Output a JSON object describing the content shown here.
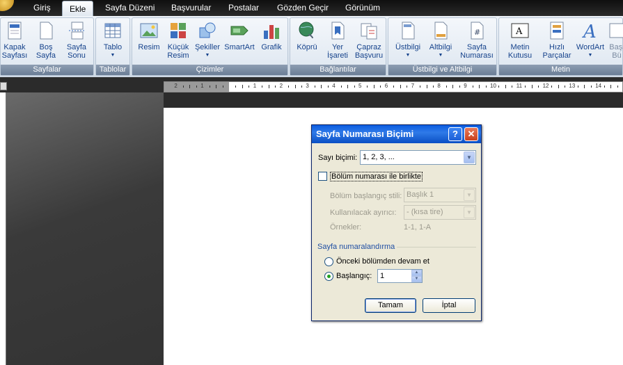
{
  "tabs": [
    "Giriş",
    "Ekle",
    "Sayfa Düzeni",
    "Başvurular",
    "Postalar",
    "Gözden Geçir",
    "Görünüm"
  ],
  "active_tab": "Ekle",
  "groups": {
    "sayfalar": {
      "label": "Sayfalar",
      "buttons": [
        {
          "l1": "Kapak",
          "l2": "Sayfası"
        },
        {
          "l1": "Boş",
          "l2": "Sayfa"
        },
        {
          "l1": "Sayfa",
          "l2": "Sonu"
        }
      ]
    },
    "tablolar": {
      "label": "Tablolar",
      "buttons": [
        {
          "l1": "Tablo",
          "l2": ""
        }
      ]
    },
    "cizimler": {
      "label": "Çizimler",
      "buttons": [
        {
          "l1": "Resim",
          "l2": ""
        },
        {
          "l1": "Küçük",
          "l2": "Resim"
        },
        {
          "l1": "Şekiller",
          "l2": ""
        },
        {
          "l1": "SmartArt",
          "l2": ""
        },
        {
          "l1": "Grafik",
          "l2": ""
        }
      ]
    },
    "baglantilar": {
      "label": "Bağlantılar",
      "buttons": [
        {
          "l1": "Köprü",
          "l2": ""
        },
        {
          "l1": "Yer",
          "l2": "İşareti"
        },
        {
          "l1": "Çapraz",
          "l2": "Başvuru"
        }
      ]
    },
    "ustbilgi": {
      "label": "Üstbilgi ve Altbilgi",
      "buttons": [
        {
          "l1": "Üstbilgi",
          "l2": ""
        },
        {
          "l1": "Altbilgi",
          "l2": ""
        },
        {
          "l1": "Sayfa",
          "l2": "Numarası"
        }
      ]
    },
    "metin": {
      "label": "Metin",
      "buttons": [
        {
          "l1": "Metin",
          "l2": "Kutusu"
        },
        {
          "l1": "Hızlı",
          "l2": "Parçalar"
        },
        {
          "l1": "WordArt",
          "l2": ""
        },
        {
          "l1": "Başl",
          "l2": "Bü"
        }
      ]
    }
  },
  "ruler_numbers": [
    "2",
    "1",
    "1",
    "2",
    "3",
    "4",
    "5",
    "6",
    "7",
    "8",
    "9",
    "10",
    "11",
    "12",
    "13",
    "14"
  ],
  "dialog": {
    "title": "Sayfa Numarası Biçimi",
    "help": "?",
    "close": "✕",
    "sayi_bicimi_label": "Sayı biçimi:",
    "sayi_bicimi_value": "1, 2, 3, ...",
    "bolum_checkbox": "Bölüm numarası ile birlikte",
    "bolum_checked": false,
    "bolum_stili_label": "Bölüm başlangıç stili:",
    "bolum_stili_value": "Başlık 1",
    "ayirici_label": "Kullanılacak ayırıcı:",
    "ayirici_value": "-   (kısa tire)",
    "ornekler_label": "Örnekler:",
    "ornekler_value": "1-1, 1-A",
    "section_label": "Sayfa numaralandırma",
    "radio1": "Önceki bölümden devam et",
    "radio2": "Başlangıç:",
    "start_value": "1",
    "ok": "Tamam",
    "cancel": "İptal"
  }
}
